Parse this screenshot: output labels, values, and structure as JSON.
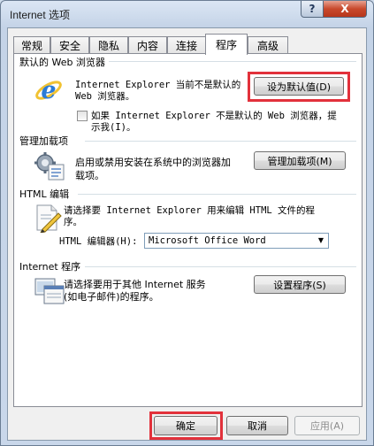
{
  "window": {
    "title": "Internet 选项",
    "help_label": "?",
    "close_label": "X"
  },
  "tabs": [
    {
      "label": "常规"
    },
    {
      "label": "安全"
    },
    {
      "label": "隐私"
    },
    {
      "label": "内容"
    },
    {
      "label": "连接"
    },
    {
      "label": "程序",
      "active": true
    },
    {
      "label": "高级"
    }
  ],
  "web_browser": {
    "group_title": "默认的 Web 浏览器",
    "line1": "Internet Explorer 当前不是默认的",
    "line2": "Web 浏览器。",
    "set_default_button": "设为默认值(D)",
    "checkbox_line1": "如果 Internet Explorer 不是默认的 Web 浏览器，提",
    "checkbox_line2": "示我(I)。",
    "checkbox_checked": false,
    "icon": "internet-explorer-icon"
  },
  "addons": {
    "group_title": "管理加载项",
    "line1": "启用或禁用安装在系统中的浏览器加",
    "line2": "载项。",
    "manage_button": "管理加载项(M)",
    "icon": "gear-addons-icon"
  },
  "html_edit": {
    "group_title": "HTML 编辑",
    "description": "请选择要 Internet Explorer 用来编辑 HTML 文件的程序。",
    "line1": "请选择要 Internet Explorer 用来编辑 HTML 文件的程",
    "line2": "序。",
    "editor_label": "HTML 编辑器(H):",
    "editor_value": "Microsoft Office Word",
    "icon": "html-edit-icon"
  },
  "programs": {
    "group_title": "Internet 程序",
    "line1": "请选择要用于其他 Internet 服务",
    "line2": "(如电子邮件)的程序。",
    "set_programs_button": "设置程序(S)",
    "icon": "internet-programs-icon"
  },
  "footer": {
    "ok_label": "确定",
    "cancel_label": "取消",
    "apply_label": "应用(A)"
  },
  "colors": {
    "highlight": "#e2313b",
    "titlebar": "#c4d3e7",
    "close_red": "#c8492c"
  }
}
